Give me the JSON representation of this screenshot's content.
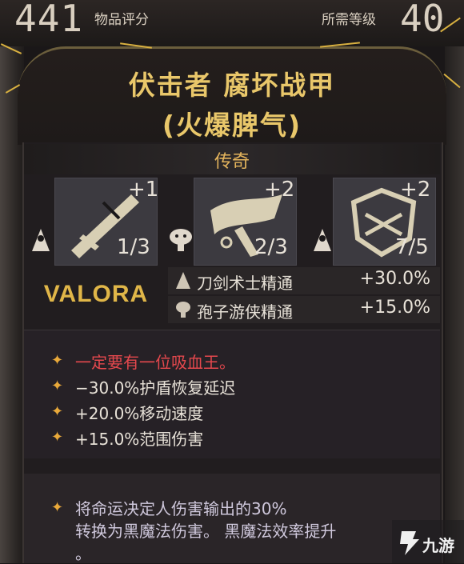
{
  "header": {
    "item_score": "441",
    "item_score_label": "物品评分",
    "required_level_label": "所需等级",
    "required_level": "40"
  },
  "item": {
    "name_line1": "伏击者 腐坏战甲",
    "name_line2": "(火爆脾气)",
    "rarity": "传奇"
  },
  "skills": [
    {
      "plus": "+1",
      "count": "1/3"
    },
    {
      "plus": "+2",
      "count": "2/3"
    },
    {
      "plus": "+2",
      "count": "7/5"
    }
  ],
  "brand": "VALORA",
  "bonuses": [
    {
      "name": "刀剑术士精通",
      "value": "+30.0%"
    },
    {
      "name": "孢子游侠精通",
      "value": "+15.0%"
    }
  ],
  "affixes": [
    {
      "text": "一定要有一位吸血王。",
      "color": "#e5484d"
    },
    {
      "text": "−30.0%护盾恢复延迟",
      "color": "#e8e2d8"
    },
    {
      "text": "+20.0%移动速度",
      "color": "#e8e2d8"
    },
    {
      "text": "+15.0%范围伤害",
      "color": "#e8e2d8"
    }
  ],
  "legendary_effect": {
    "line1": "将命运决定人伤害输出的30%",
    "line2": "转换为黑魔法伤害。 黑魔法效率提升",
    "line3": "。"
  },
  "watermark": "九游",
  "colors": {
    "title": "#e9c76a",
    "rarity": "#e4b45c",
    "bullet": "#e9a93a",
    "red_affix": "#e5484d"
  }
}
